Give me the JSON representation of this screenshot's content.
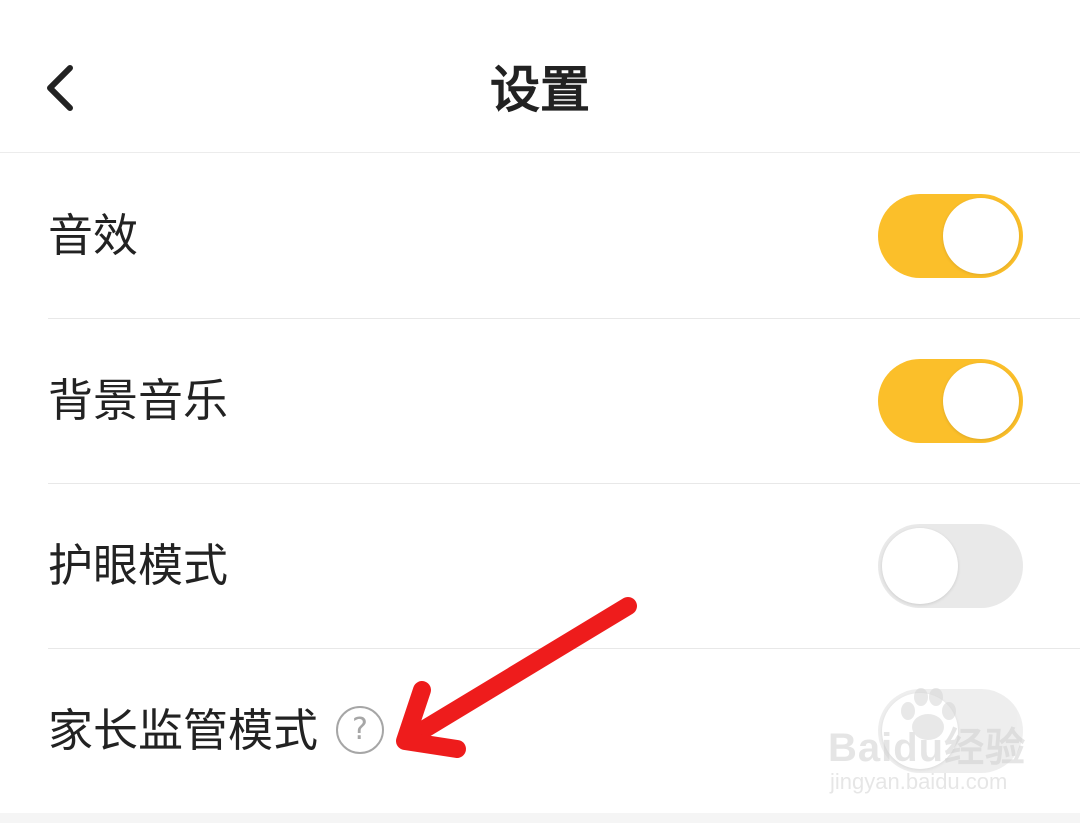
{
  "header": {
    "title": "设置",
    "back_icon": "chevron-left-icon"
  },
  "settings": [
    {
      "label": "音效",
      "enabled": true
    },
    {
      "label": "背景音乐",
      "enabled": true
    },
    {
      "label": "护眼模式",
      "enabled": false
    },
    {
      "label": "家长监管模式",
      "enabled": false,
      "help_icon_glyph": "?"
    }
  ],
  "watermark": {
    "logo": "Baidu经验",
    "url": "jingyan.baidu.com"
  },
  "colors": {
    "toggle_on": "#fbbf2a",
    "toggle_off": "#e9e9e9",
    "annotation_arrow": "#ee1c1c"
  }
}
